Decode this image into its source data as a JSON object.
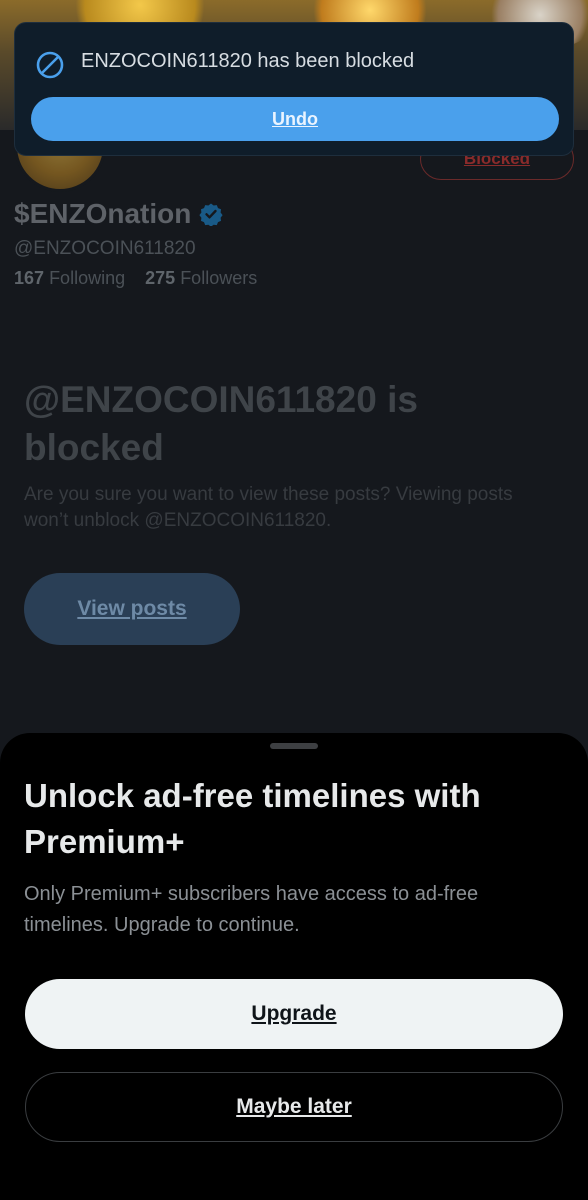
{
  "toast": {
    "icon": "blocked-circle-icon",
    "message": "ENZOCOIN611820 has been blocked",
    "undo_label": "Undo"
  },
  "profile": {
    "display_name": "$ENZOnation",
    "verified_icon": "verified-badge-icon",
    "handle": "@ENZOCOIN611820",
    "following_count": "167",
    "following_label": "Following",
    "followers_count": "275",
    "followers_label": "Followers",
    "blocked_button_label": "Blocked"
  },
  "blocked_notice": {
    "title": "@ENZOCOIN611820 is blocked",
    "description": "Are you sure you want to view these posts? Viewing posts won’t unblock @ENZOCOIN611820.",
    "view_posts_label": "View posts"
  },
  "sheet": {
    "title": "Unlock ad-free timelines with Premium+",
    "description": "Only Premium+ subscribers have access to ad-free timelines. Upgrade to continue.",
    "upgrade_label": "Upgrade",
    "maybe_later_label": "Maybe later"
  },
  "colors": {
    "accent": "#4aa0ec",
    "background": "#15181d",
    "sheet_background": "#000000"
  }
}
